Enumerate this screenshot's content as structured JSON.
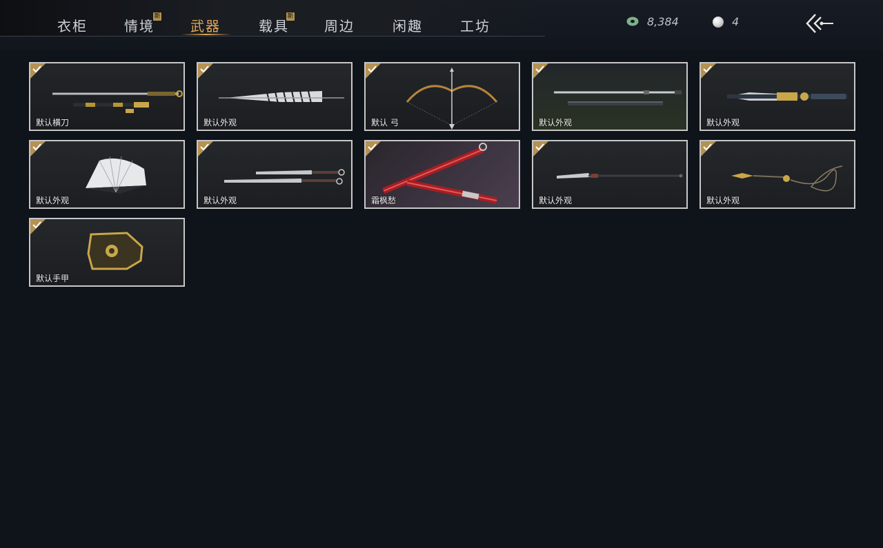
{
  "tabs": [
    {
      "label": "衣柜",
      "new": false,
      "active": false
    },
    {
      "label": "情境",
      "new": true,
      "active": false
    },
    {
      "label": "武器",
      "new": false,
      "active": true
    },
    {
      "label": "载具",
      "new": true,
      "active": false
    },
    {
      "label": "周边",
      "new": false,
      "active": false
    },
    {
      "label": "闲趣",
      "new": false,
      "active": false
    },
    {
      "label": "工坊",
      "new": false,
      "active": false
    }
  ],
  "new_badge": "新",
  "currency": {
    "jade": "8,384",
    "pearl": "4"
  },
  "items": [
    {
      "name": "默认横刀",
      "icon": "blade-icon"
    },
    {
      "name": "默认外观",
      "icon": "umbrella-icon"
    },
    {
      "name": "默认 弓",
      "icon": "bow-icon"
    },
    {
      "name": "默认外观",
      "icon": "twin-sword-icon"
    },
    {
      "name": "默认外观",
      "icon": "ornate-spear-icon"
    },
    {
      "name": "默认外观",
      "icon": "fan-icon"
    },
    {
      "name": "默认外观",
      "icon": "dual-blades-icon"
    },
    {
      "name": "霜枫愁",
      "icon": "red-twin-blades-icon"
    },
    {
      "name": "默认外观",
      "icon": "glaive-icon"
    },
    {
      "name": "默认外观",
      "icon": "rope-dart-icon"
    },
    {
      "name": "默认手甲",
      "icon": "gauntlet-icon"
    }
  ],
  "colors": {
    "accent": "#e0a856",
    "background": "#0f131a",
    "card_border": "#c8c8c8",
    "check": "#b59253"
  }
}
